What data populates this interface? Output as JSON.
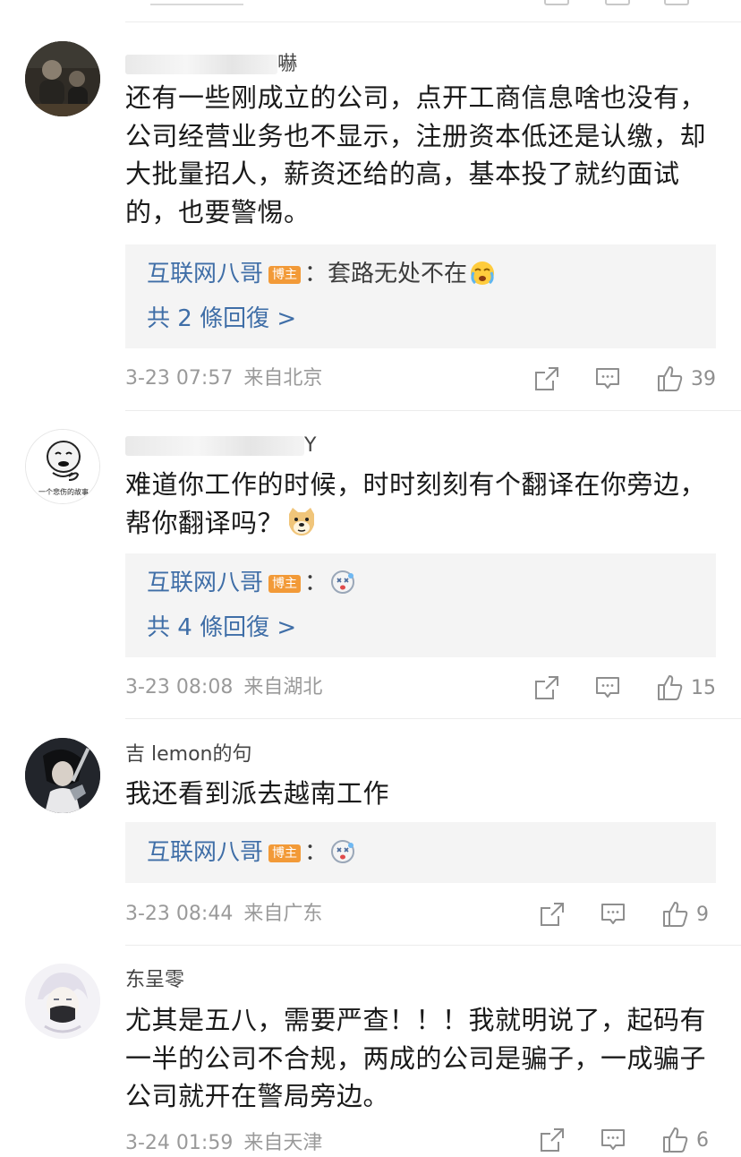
{
  "op_label": "博主",
  "comments": [
    {
      "username_visible": "嚇",
      "text": "还有一些刚成立的公司，点开工商信息啥也没有，公司经营业务也不显示，注册资本低还是认缴，却大批量招人，薪资还给的高，基本投了就约面试的，也要警惕。",
      "reply": {
        "author": "互联网八哥",
        "text": "：套路无处不在",
        "emoji": "crying-face-emoji"
      },
      "reply_count": "共 2 條回復 >",
      "date": "3-23 07:57",
      "location": "来自北京",
      "likes": "39"
    },
    {
      "username_visible": "Y",
      "avatar_caption": "一个悲伤的故事",
      "text": "难道你工作的时候，时时刻刻有个翻译在你旁边，帮你翻译吗？",
      "text_emoji": "doge-emoji",
      "reply": {
        "author": "互联网八哥",
        "text": "：",
        "emoji": "dizzy-face-emoji"
      },
      "reply_count": "共 4 條回復 >",
      "date": "3-23 08:08",
      "location": "来自湖北",
      "likes": "15"
    },
    {
      "username_visible": "吉 lemon的句",
      "text": "我还看到派去越南工作",
      "reply": {
        "author": "互联网八哥",
        "text": "：",
        "emoji": "dizzy-face-emoji"
      },
      "date": "3-23 08:44",
      "location": "来自广东",
      "likes": "9"
    },
    {
      "username_visible": "东呈零",
      "text": "尤其是五八，需要严查！！！我就明说了，起码有一半的公司不合规，两成的公司是骗子，一成骗子公司就开在警局旁边。",
      "date": "3-24 01:59",
      "location": "来自天津",
      "likes": "6"
    }
  ]
}
